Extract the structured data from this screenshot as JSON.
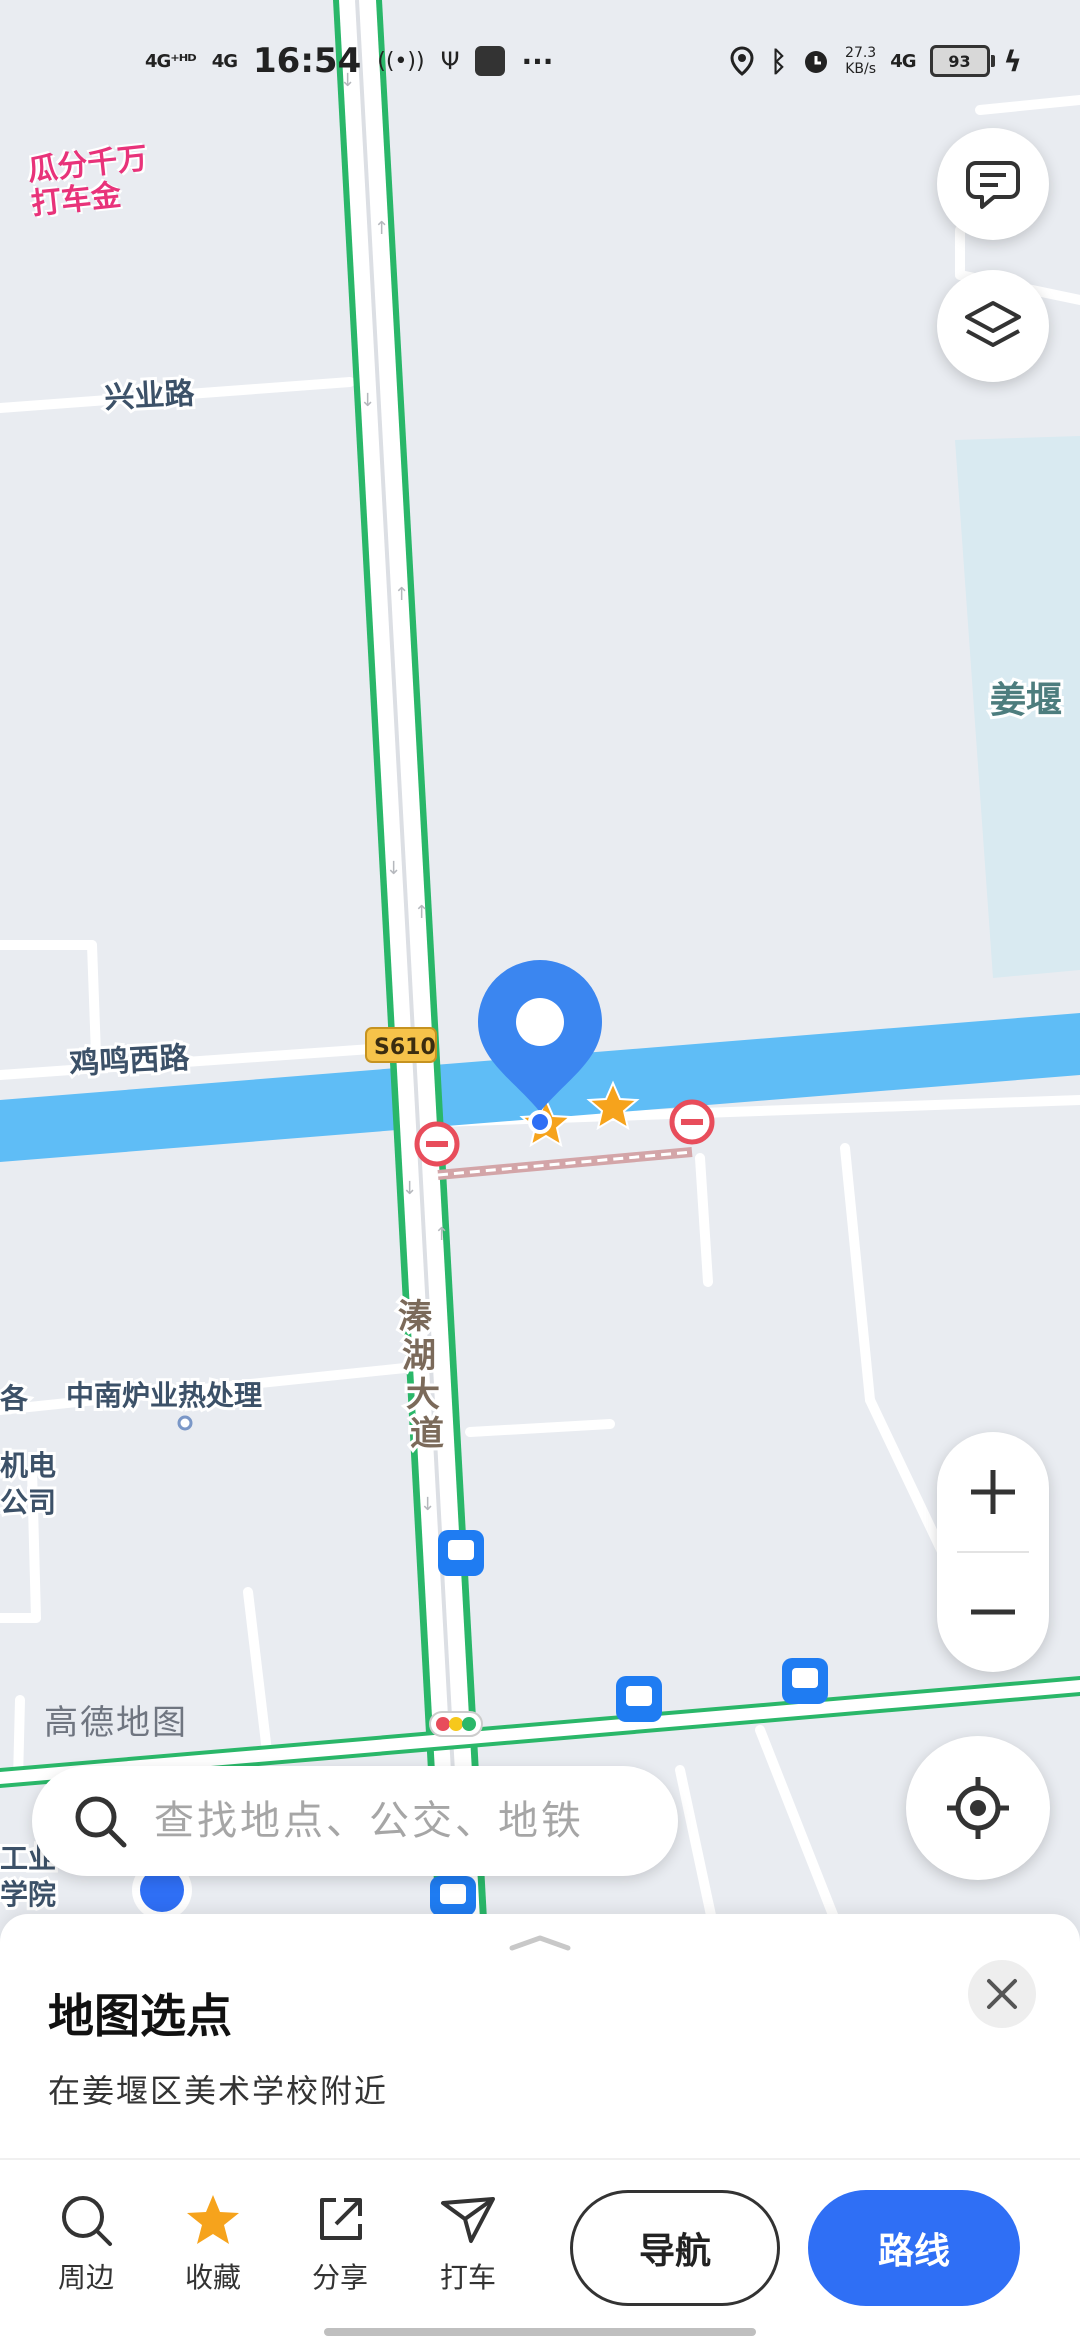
{
  "status_bar": {
    "signal_1": "4G⁺ᴴᴰ",
    "signal_2": "4G",
    "time": "16:54",
    "speed_value": "27.3",
    "speed_unit": "KB/s",
    "network": "4G",
    "battery": "93"
  },
  "map": {
    "promo_line1": "瓜分千万",
    "promo_line2": "打车金",
    "road_xingye": "兴业路",
    "road_jiming": "鸡鸣西路",
    "road_badge": "S610",
    "road_qinhu_1": "溱",
    "road_qinhu_2": "湖",
    "road_qinhu_3": "大",
    "road_qinhu_4": "道",
    "poi_zhongnan": "中南炉业热处理",
    "poi_jiangyan": "姜堰",
    "poi_left_1": "机电",
    "poi_left_2": "公司",
    "poi_left_3": "工业",
    "poi_left_4": "学院",
    "poi_left_5": "各",
    "watermark": "高德地图"
  },
  "search": {
    "placeholder": "查找地点、公交、地铁"
  },
  "sheet": {
    "title": "地图选点",
    "subtitle": "在姜堰区美术学校附近"
  },
  "actions": [
    {
      "label": "周边",
      "icon": "search-icon"
    },
    {
      "label": "收藏",
      "icon": "star-icon"
    },
    {
      "label": "分享",
      "icon": "share-icon"
    },
    {
      "label": "打车",
      "icon": "taxi-icon"
    }
  ],
  "buttons": {
    "navigate": "导航",
    "route": "路线"
  },
  "colors": {
    "accent": "#2f6ff5",
    "pin": "#3b86f0",
    "river": "#5fbdf6",
    "road_outline": "#2ab769",
    "star": "#f6a31c"
  }
}
